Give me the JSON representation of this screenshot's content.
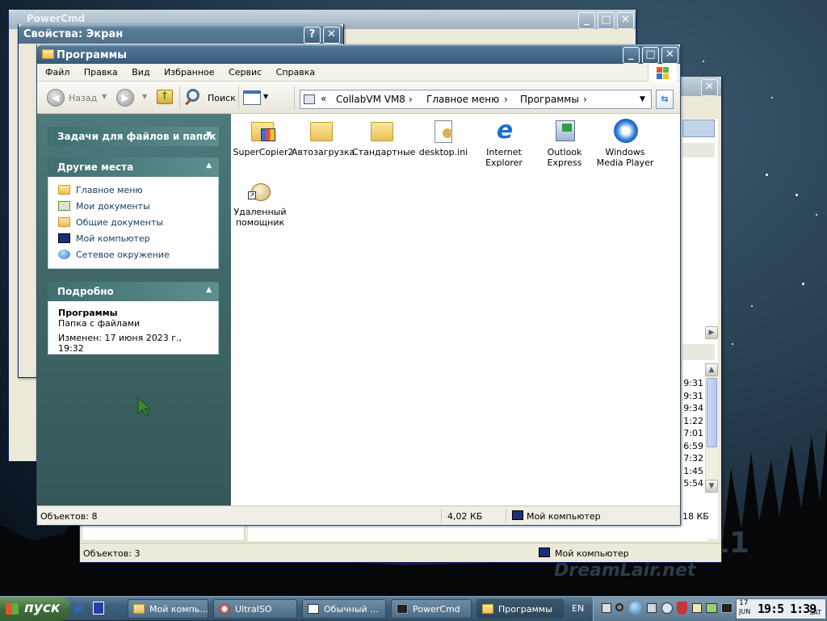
{
  "background_windows": {
    "powercmd_title": "PowerCmd",
    "display_props_title": "Свойства: Экран",
    "back_window": {
      "status_count": "Объектов: 3",
      "status_location": "Мой компьютер",
      "size": "18 КБ",
      "times": [
        "9:31",
        "9:31",
        "9:34",
        "1:22",
        "7:01",
        "6:59",
        "7:32",
        "1:45",
        "5:54"
      ]
    }
  },
  "explorer": {
    "title": "Программы",
    "menu": [
      "Файл",
      "Правка",
      "Вид",
      "Избранное",
      "Сервис",
      "Справка"
    ],
    "toolbar": {
      "back": "Назад",
      "search": "Поиск"
    },
    "address": {
      "chevron": "«",
      "parts": [
        "CollabVM VM8",
        "Главное меню",
        "Программы"
      ]
    },
    "tasks_panel": {
      "title": "Задачи для файлов и папок"
    },
    "other_places": {
      "title": "Другие места",
      "items": [
        "Главное меню",
        "Мои документы",
        "Общие документы",
        "Мой компьютер",
        "Сетевое окружение"
      ]
    },
    "details": {
      "title": "Подробно",
      "name": "Программы",
      "type": "Папка с файлами",
      "modified": "Изменен: 17 июня 2023 г., 19:32"
    },
    "items": [
      {
        "label": "SuperCopier2",
        "icon": "folder-program-icon"
      },
      {
        "label": "Автозагрузка",
        "icon": "folder-icon"
      },
      {
        "label": "Стандартные",
        "icon": "folder-icon"
      },
      {
        "label": "desktop.ini",
        "icon": "ini-file-icon"
      },
      {
        "label": "Internet Explorer",
        "icon": "internet-explorer-icon"
      },
      {
        "label": "Outlook Express",
        "icon": "outlook-express-icon"
      },
      {
        "label": "Windows Media Player",
        "icon": "media-player-icon"
      },
      {
        "label": "Удаленный помощник",
        "icon": "remote-assistant-icon"
      }
    ],
    "status": {
      "count": "Объектов: 8",
      "size": "4,02 КБ",
      "location": "Мой компьютер"
    }
  },
  "taskbar": {
    "start": "пуск",
    "tasks": [
      "Мой компь...",
      "UltraISO",
      "Обычный ...",
      "PowerCmd",
      "Программы"
    ],
    "lang": "EN",
    "clock_date_day": "17",
    "clock_date_month": "JUN",
    "clock_time": "19:5 1:39",
    "clock_weekday": "SAT"
  },
  "wallpaper": {
    "brand": "DreamLair.net",
    "number": "11"
  },
  "colors": {
    "accent": "#4d7a7a",
    "titlebar": "#46698a"
  }
}
